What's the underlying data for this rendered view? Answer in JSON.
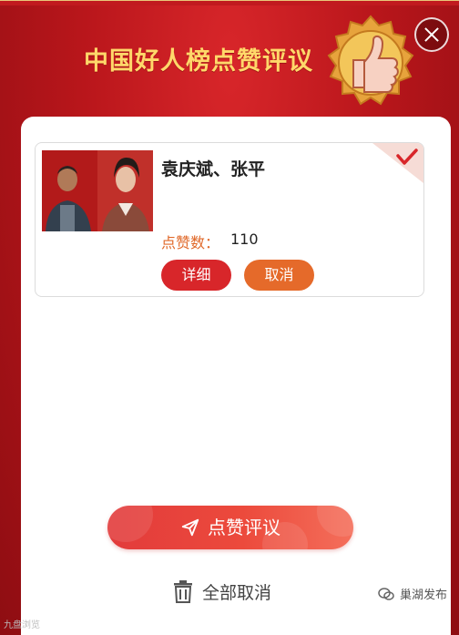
{
  "header": {
    "title": "中国好人榜点赞评议",
    "close_icon": "close-icon",
    "badge_icon": "thumbs-up-icon"
  },
  "candidate": {
    "name": "袁庆斌、张平",
    "likes_label": "点赞数：",
    "likes_value": "110",
    "detail_label": "详细",
    "cancel_label": "取消",
    "selected": true
  },
  "actions": {
    "submit_label": "点赞评议",
    "clear_all_label": "全部取消"
  },
  "watermarks": {
    "left": "九盘浏览",
    "right": "巢湖发布"
  },
  "colors": {
    "primary_red": "#d8262a",
    "accent_orange": "#e56a2a",
    "title_gold": "#ffd86a"
  }
}
